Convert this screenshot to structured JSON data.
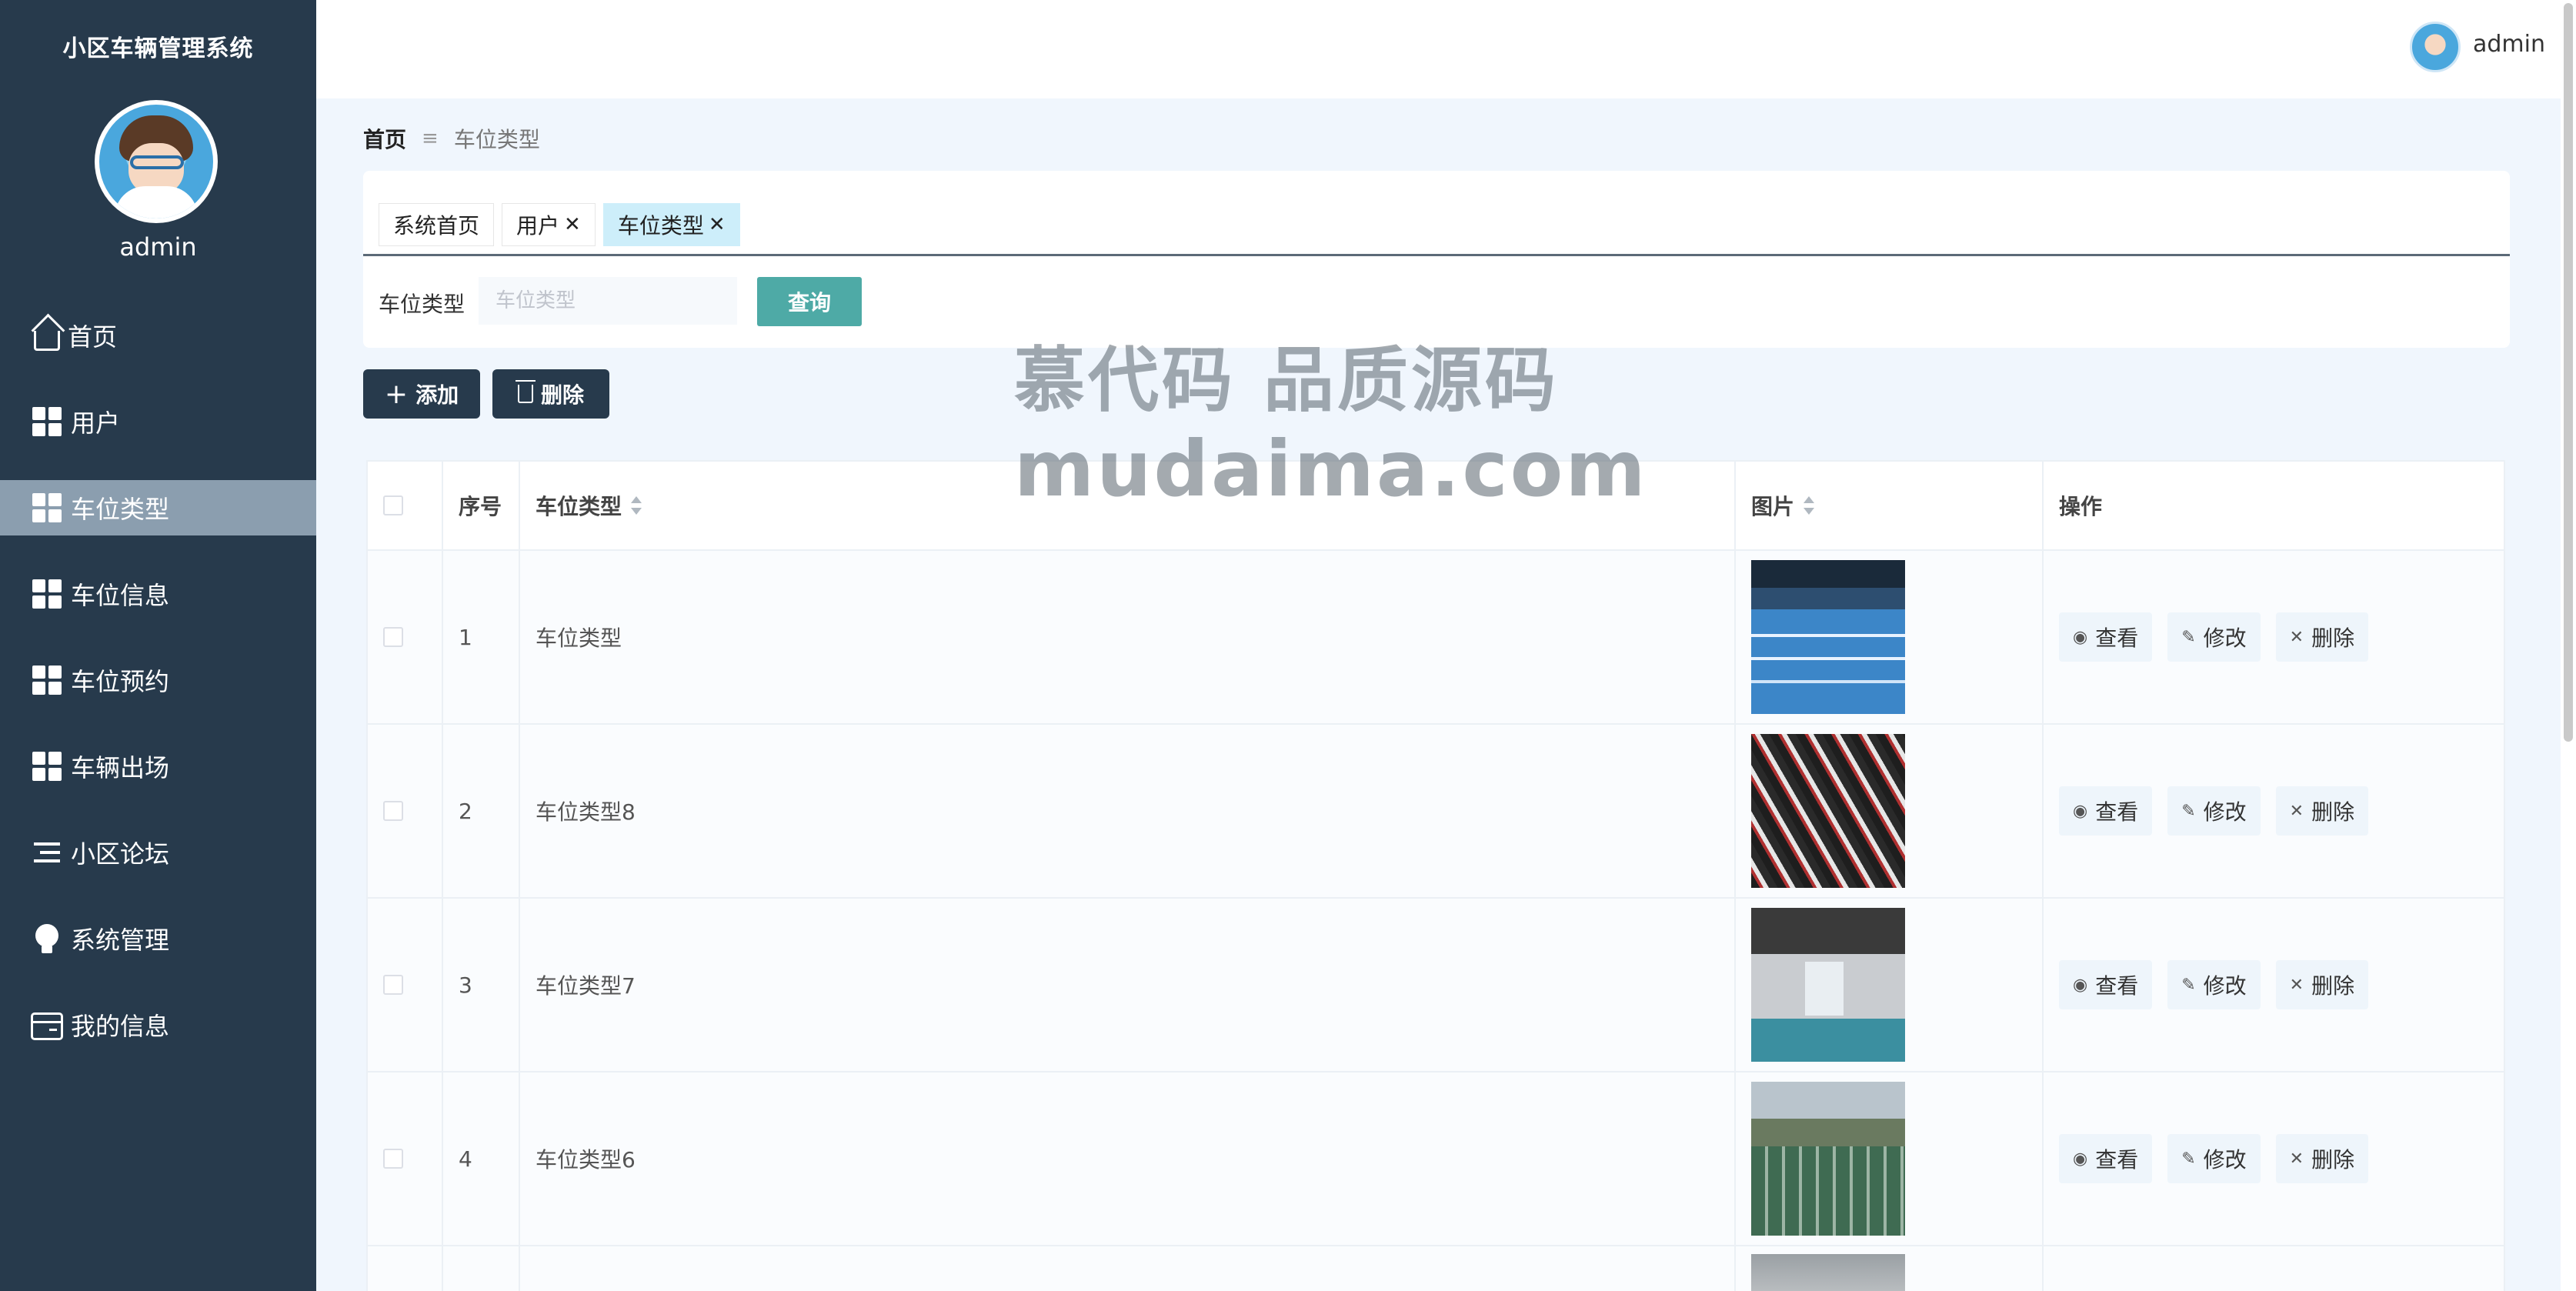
{
  "app": {
    "title": "小区车辆管理系统",
    "user": "admin"
  },
  "sidebar": {
    "items": [
      {
        "label": "首页",
        "icon": "home-icon"
      },
      {
        "label": "用户",
        "icon": "grid-icon"
      },
      {
        "label": "车位类型",
        "icon": "grid-icon",
        "active": true
      },
      {
        "label": "车位信息",
        "icon": "grid-icon"
      },
      {
        "label": "车位预约",
        "icon": "grid-icon"
      },
      {
        "label": "车辆出场",
        "icon": "grid-icon"
      },
      {
        "label": "小区论坛",
        "icon": "list-icon"
      },
      {
        "label": "系统管理",
        "icon": "bulb-icon"
      },
      {
        "label": "我的信息",
        "icon": "card-icon"
      }
    ]
  },
  "breadcrumb": {
    "home": "首页",
    "separator": "≡",
    "current": "车位类型"
  },
  "tabs": [
    {
      "label": "系统首页",
      "closable": false
    },
    {
      "label": "用户",
      "closable": true
    },
    {
      "label": "车位类型",
      "closable": true,
      "active": true
    }
  ],
  "search": {
    "label": "车位类型",
    "placeholder": "车位类型",
    "button": "查询"
  },
  "actions": {
    "add": "添加",
    "delete": "删除"
  },
  "watermark": {
    "line1": "慕代码 品质源码",
    "line2": "mudaima.com"
  },
  "table": {
    "headers": {
      "index": "序号",
      "name": "车位类型",
      "image": "图片",
      "ops": "操作"
    },
    "rows": [
      {
        "index": "1",
        "name": "车位类型"
      },
      {
        "index": "2",
        "name": "车位类型8"
      },
      {
        "index": "3",
        "name": "车位类型7"
      },
      {
        "index": "4",
        "name": "车位类型6"
      }
    ],
    "ops": {
      "view": "查看",
      "edit": "修改",
      "delete": "删除"
    }
  },
  "colors": {
    "sidebar": "#273a4c",
    "active": "#8b9eaf",
    "accent": "#4eaaa6",
    "tab_active": "#cdeefa"
  }
}
